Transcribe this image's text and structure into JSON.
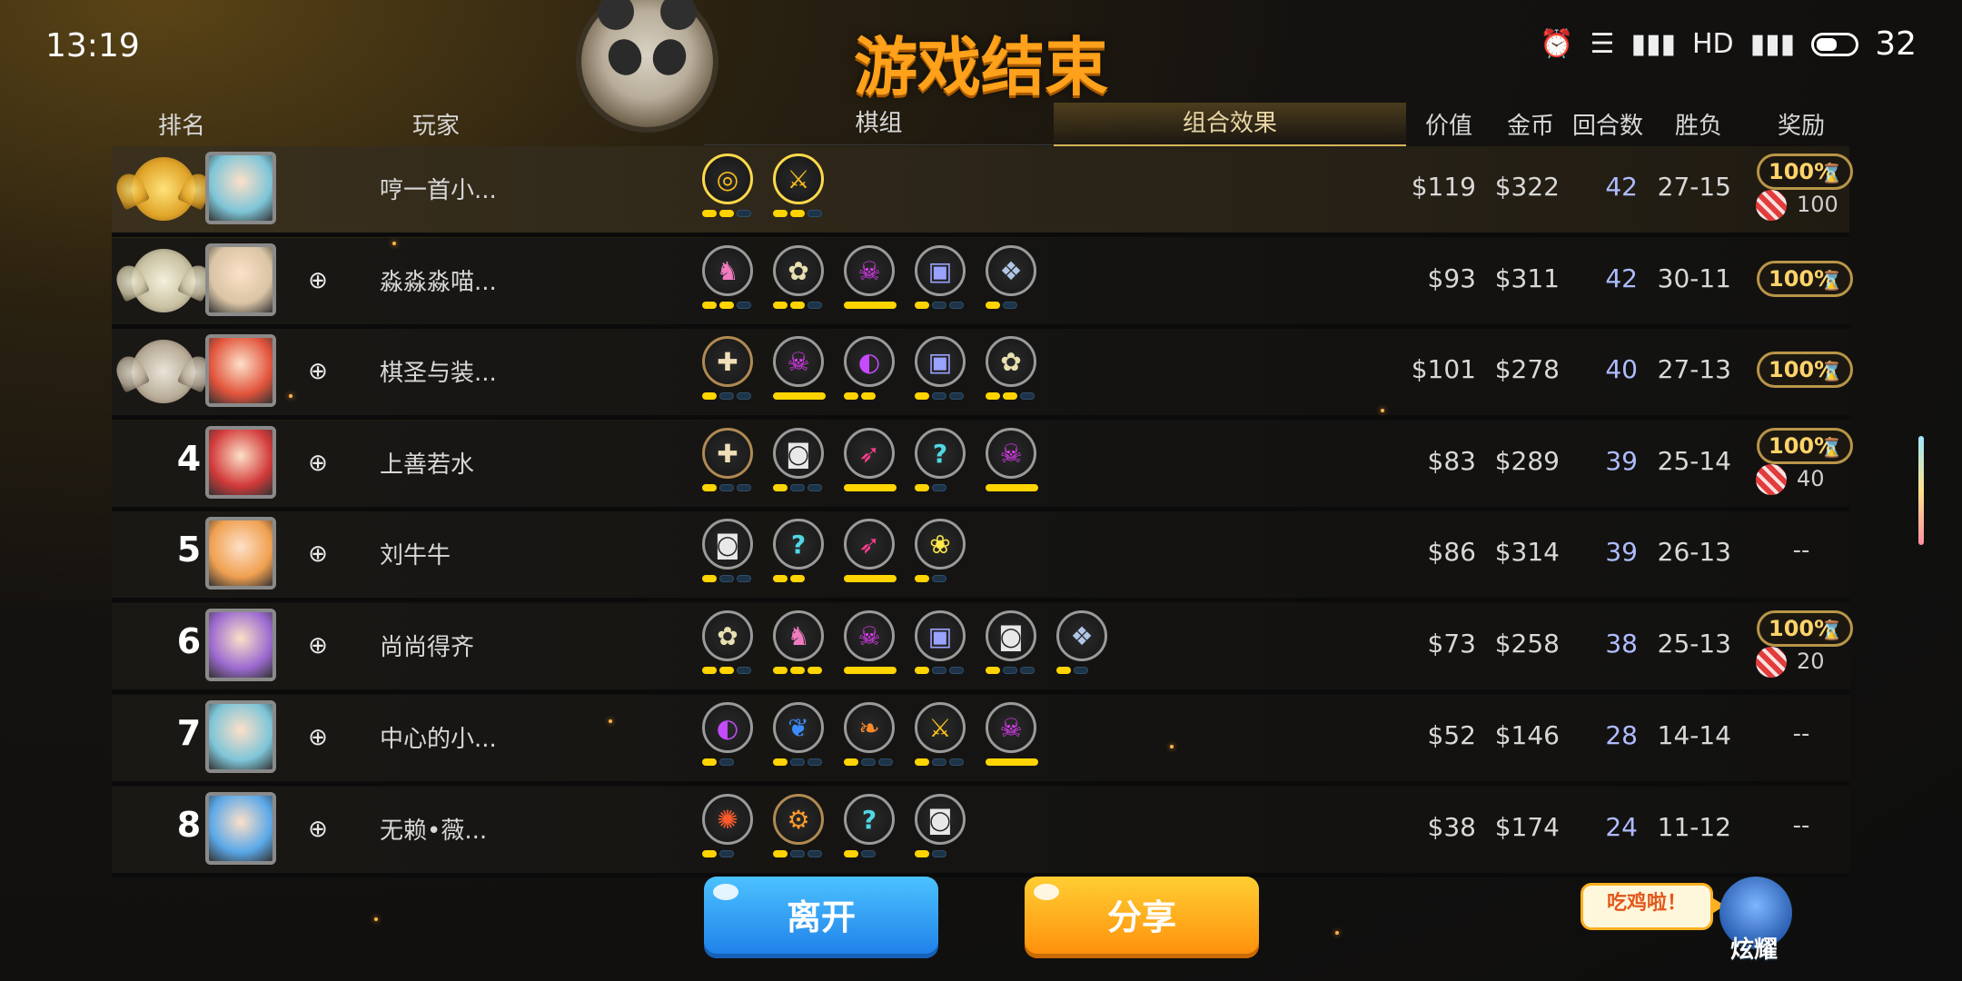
{
  "status_bar": {
    "time": "13:19",
    "battery": "32",
    "icons": [
      "alarm-icon",
      "data-arrows-icon",
      "4g-signal-icon",
      "hd-icon",
      "4g-signal-icon",
      "battery-icon"
    ]
  },
  "title": "游戏结束",
  "headers": {
    "rank": "排名",
    "player": "玩家",
    "tab_chess": "棋组",
    "tab_combo": "组合效果",
    "value": "价值",
    "gold": "金币",
    "rounds": "回合数",
    "winloss": "胜负",
    "reward": "奖励"
  },
  "rows": [
    {
      "rank": "1",
      "rank_style": "gold",
      "avatar_color": "#7ec5d8",
      "name": "哼一首小...",
      "value": "$119",
      "gold": "$322",
      "rounds": "42",
      "winloss": "27-15",
      "reward_pct": "100%",
      "candy": "100",
      "add_friend": false,
      "traits": [
        {
          "glyph": "◎",
          "color": "#ffc21a",
          "border": "#ffd94a",
          "bars": [
            1,
            1,
            0
          ]
        },
        {
          "glyph": "⚔",
          "color": "#ffc21a",
          "border": "#ffd94a",
          "bars": [
            1,
            1,
            0
          ]
        }
      ]
    },
    {
      "rank": "2",
      "rank_style": "silver",
      "avatar_color": "#d9c4a4",
      "name": "淼淼淼喵...",
      "value": "$93",
      "gold": "$311",
      "rounds": "42",
      "winloss": "30-11",
      "reward_pct": "100%",
      "candy": "",
      "add_friend": true,
      "traits": [
        {
          "glyph": "♞",
          "color": "#f07cc0",
          "border": "#9a9a9a",
          "bars": [
            1,
            1,
            0
          ]
        },
        {
          "glyph": "✿",
          "color": "#e8e0b0",
          "border": "#9a9a9a",
          "bars": [
            1,
            1,
            0
          ]
        },
        {
          "glyph": "☠",
          "color": "#e93bff",
          "border": "#9a9a9a",
          "bars": [
            2
          ]
        },
        {
          "glyph": "▣",
          "color": "#9aa2ff",
          "border": "#9a9a9a",
          "bars": [
            1,
            0,
            0
          ]
        },
        {
          "glyph": "❖",
          "color": "#b0c6e6",
          "border": "#9a9a9a",
          "bars": [
            1,
            0
          ]
        }
      ]
    },
    {
      "rank": "3",
      "rank_style": "bronze",
      "avatar_color": "#e2543c",
      "name": "棋圣与装...",
      "value": "$101",
      "gold": "$278",
      "rounds": "40",
      "winloss": "27-13",
      "reward_pct": "100%",
      "candy": "",
      "add_friend": true,
      "traits": [
        {
          "glyph": "✚",
          "color": "#f1dfb8",
          "border": "#b08a52",
          "bars": [
            1,
            0,
            0
          ]
        },
        {
          "glyph": "☠",
          "color": "#e93bff",
          "border": "#9a9a9a",
          "bars": [
            2
          ]
        },
        {
          "glyph": "◐",
          "color": "#c54bff",
          "border": "#9a9a9a",
          "bars": [
            1,
            1
          ]
        },
        {
          "glyph": "▣",
          "color": "#9aa2ff",
          "border": "#9a9a9a",
          "bars": [
            1,
            0,
            0
          ]
        },
        {
          "glyph": "✿",
          "color": "#e8e0b0",
          "border": "#9a9a9a",
          "bars": [
            1,
            1,
            0
          ]
        }
      ]
    },
    {
      "rank": "4",
      "rank_style": "number",
      "avatar_color": "#d23a3a",
      "name": "上善若水",
      "value": "$83",
      "gold": "$289",
      "rounds": "39",
      "winloss": "25-14",
      "reward_pct": "100%",
      "candy": "40",
      "add_friend": true,
      "traits": [
        {
          "glyph": "✚",
          "color": "#f1dfb8",
          "border": "#b08a52",
          "bars": [
            1,
            0,
            0
          ]
        },
        {
          "glyph": "◙",
          "color": "#e8e8e8",
          "border": "#9a9a9a",
          "bars": [
            1,
            0,
            0
          ]
        },
        {
          "glyph": "➶",
          "color": "#ff3d8e",
          "border": "#9a9a9a",
          "bars": [
            2
          ]
        },
        {
          "glyph": "?",
          "color": "#4fd8e6",
          "border": "#9a9a9a",
          "bars": [
            1,
            0
          ]
        },
        {
          "glyph": "☠",
          "color": "#e93bff",
          "border": "#9a9a9a",
          "bars": [
            2
          ]
        }
      ]
    },
    {
      "rank": "5",
      "rank_style": "number",
      "avatar_color": "#f0a050",
      "name": "刘牛牛",
      "value": "$86",
      "gold": "$314",
      "rounds": "39",
      "winloss": "26-13",
      "reward_pct": "",
      "candy": "",
      "add_friend": true,
      "traits": [
        {
          "glyph": "◙",
          "color": "#e8e8e8",
          "border": "#9a9a9a",
          "bars": [
            1,
            0,
            0
          ]
        },
        {
          "glyph": "?",
          "color": "#4fd8e6",
          "border": "#9a9a9a",
          "bars": [
            1,
            1
          ]
        },
        {
          "glyph": "➶",
          "color": "#ff3d8e",
          "border": "#9a9a9a",
          "bars": [
            2
          ]
        },
        {
          "glyph": "❀",
          "color": "#ffe84a",
          "border": "#9a9a9a",
          "bars": [
            1,
            0
          ]
        }
      ]
    },
    {
      "rank": "6",
      "rank_style": "number",
      "avatar_color": "#9c6ad0",
      "name": "尚尚得齐",
      "value": "$73",
      "gold": "$258",
      "rounds": "38",
      "winloss": "25-13",
      "reward_pct": "100%",
      "candy": "20",
      "add_friend": true,
      "traits": [
        {
          "glyph": "✿",
          "color": "#e8e0b0",
          "border": "#9a9a9a",
          "bars": [
            1,
            1,
            0
          ]
        },
        {
          "glyph": "♞",
          "color": "#f07cc0",
          "border": "#9a9a9a",
          "bars": [
            1,
            1,
            1
          ]
        },
        {
          "glyph": "☠",
          "color": "#e93bff",
          "border": "#9a9a9a",
          "bars": [
            2
          ]
        },
        {
          "glyph": "▣",
          "color": "#9aa2ff",
          "border": "#9a9a9a",
          "bars": [
            1,
            0,
            0
          ]
        },
        {
          "glyph": "◙",
          "color": "#e8e8e8",
          "border": "#9a9a9a",
          "bars": [
            1,
            0,
            0
          ]
        },
        {
          "glyph": "❖",
          "color": "#b0c6e6",
          "border": "#9a9a9a",
          "bars": [
            1,
            0
          ]
        }
      ]
    },
    {
      "rank": "7",
      "rank_style": "number",
      "avatar_color": "#7ec5d8",
      "name": "中心的小...",
      "value": "$52",
      "gold": "$146",
      "rounds": "28",
      "winloss": "14-14",
      "reward_pct": "",
      "candy": "",
      "add_friend": true,
      "traits": [
        {
          "glyph": "◐",
          "color": "#c54bff",
          "border": "#9a9a9a",
          "bars": [
            1,
            0
          ]
        },
        {
          "glyph": "❦",
          "color": "#3b8cff",
          "border": "#9a9a9a",
          "bars": [
            1,
            0,
            0
          ]
        },
        {
          "glyph": "❧",
          "color": "#ff8a2a",
          "border": "#9a9a9a",
          "bars": [
            1,
            0,
            0
          ]
        },
        {
          "glyph": "⚔",
          "color": "#ffc21a",
          "border": "#9a9a9a",
          "bars": [
            1,
            0,
            0
          ]
        },
        {
          "glyph": "☠",
          "color": "#e93bff",
          "border": "#9a9a9a",
          "bars": [
            2
          ]
        }
      ]
    },
    {
      "rank": "8",
      "rank_style": "number",
      "avatar_color": "#5aa8e8",
      "name": "无赖•薇...",
      "value": "$38",
      "gold": "$174",
      "rounds": "24",
      "winloss": "11-12",
      "reward_pct": "",
      "candy": "",
      "add_friend": true,
      "traits": [
        {
          "glyph": "✺",
          "color": "#ff5a2a",
          "border": "#9a9a9a",
          "bars": [
            1,
            0
          ]
        },
        {
          "glyph": "⚙",
          "color": "#ff9a2a",
          "border": "#b08a52",
          "bars": [
            1,
            0,
            0
          ]
        },
        {
          "glyph": "?",
          "color": "#4fd8e6",
          "border": "#9a9a9a",
          "bars": [
            1,
            0
          ]
        },
        {
          "glyph": "◙",
          "color": "#e8e8e8",
          "border": "#9a9a9a",
          "bars": [
            1,
            0
          ]
        }
      ]
    }
  ],
  "empty_reward": "--",
  "buttons": {
    "leave": "离开",
    "share": "分享"
  },
  "brag": {
    "bubble": "吃鸡啦！",
    "label": "炫耀"
  }
}
